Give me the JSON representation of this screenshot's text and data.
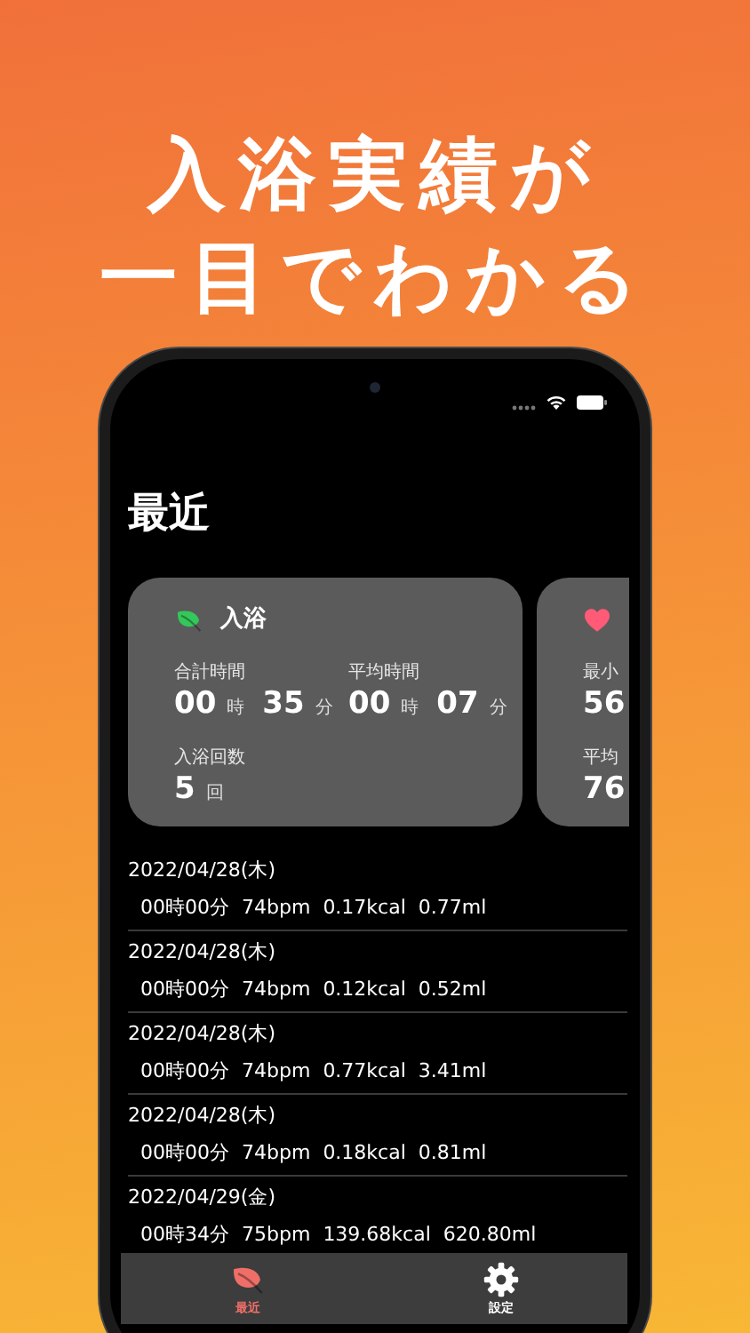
{
  "headline": [
    "入浴実績が",
    "一目でわかる"
  ],
  "screen_title": "最近",
  "cards": [
    {
      "kind": "leaf",
      "title": "入浴",
      "color": "#34c759",
      "stats": [
        {
          "label": "合計時間",
          "values": [
            {
              "number": "00",
              "unit": "時"
            },
            {
              "number": "35",
              "unit": "分"
            }
          ]
        },
        {
          "label": "平均時間",
          "values": [
            {
              "number": "00",
              "unit": "時"
            },
            {
              "number": "07",
              "unit": "分"
            }
          ]
        },
        {
          "label": "入浴回数",
          "values": [
            {
              "number": "5",
              "unit": "回"
            }
          ]
        }
      ]
    },
    {
      "kind": "heart",
      "color": "#ff5a76",
      "stats": [
        {
          "label": "最小",
          "values": [
            {
              "number": "56"
            }
          ]
        },
        {
          "label": "平均",
          "values": [
            {
              "number": "76"
            }
          ]
        }
      ]
    }
  ],
  "history": [
    {
      "date": "2022/04/28(木)",
      "duration": "00時00分",
      "heart_rate": "74bpm",
      "calories": "0.17kcal",
      "volume": "0.77ml"
    },
    {
      "date": "2022/04/28(木)",
      "duration": "00時00分",
      "heart_rate": "74bpm",
      "calories": "0.12kcal",
      "volume": "0.52ml"
    },
    {
      "date": "2022/04/28(木)",
      "duration": "00時00分",
      "heart_rate": "74bpm",
      "calories": "0.77kcal",
      "volume": "3.41ml"
    },
    {
      "date": "2022/04/28(木)",
      "duration": "00時00分",
      "heart_rate": "74bpm",
      "calories": "0.18kcal",
      "volume": "0.81ml"
    },
    {
      "date": "2022/04/29(金)",
      "duration": "00時34分",
      "heart_rate": "75bpm",
      "calories": "139.68kcal",
      "volume": "620.80ml"
    }
  ],
  "tabs": [
    {
      "kind": "leaf",
      "label": "最近",
      "selected": true
    },
    {
      "kind": "gear",
      "label": "設定",
      "selected": false
    }
  ]
}
